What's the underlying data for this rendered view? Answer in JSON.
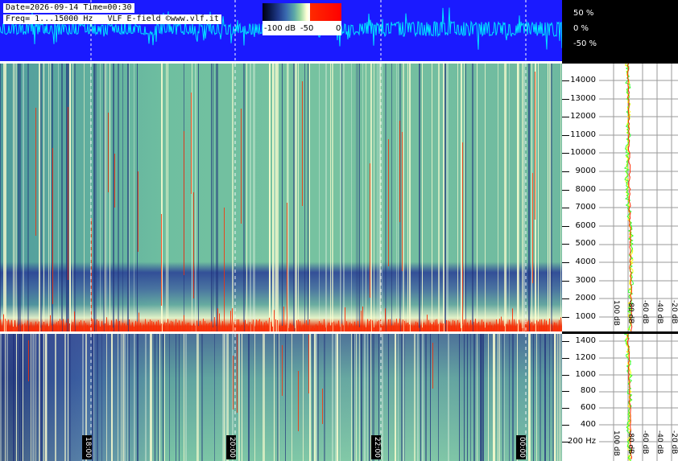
{
  "header": {
    "date_time": "Date=2026-09-14 Time=00:30",
    "freq_line": "Freq= 1...15000 Hz",
    "source": "VLF E-field ©www.vlf.it"
  },
  "colorbar": {
    "labels": [
      "-100 dB",
      "-50",
      "0"
    ]
  },
  "waveform_axis": {
    "labels": [
      "50 %",
      "0 %",
      "-50 %"
    ]
  },
  "main_freq_axis": {
    "labels": [
      "14000",
      "13000",
      "12000",
      "11000",
      "10000",
      "9000",
      "8000",
      "7000",
      "6000",
      "5000",
      "4000",
      "3000",
      "2000",
      "1000"
    ]
  },
  "low_freq_axis": {
    "labels": [
      "1400",
      "1200",
      "1000",
      "800",
      "600",
      "400",
      "200 Hz"
    ]
  },
  "profile_db_labels": [
    "100 dB",
    "-80 dB",
    "-60 dB",
    "-40 dB",
    "-20 dB"
  ],
  "time_labels": [
    "18:00",
    "20:00",
    "22:00",
    "00:00"
  ],
  "colors": {
    "waveform_bg": "#1a1aff",
    "waveform_trace": "#00e5ff",
    "spectrum_red": "#ff2a00",
    "profile_yellow": "#ffff00",
    "profile_green": "#33ff33"
  }
}
